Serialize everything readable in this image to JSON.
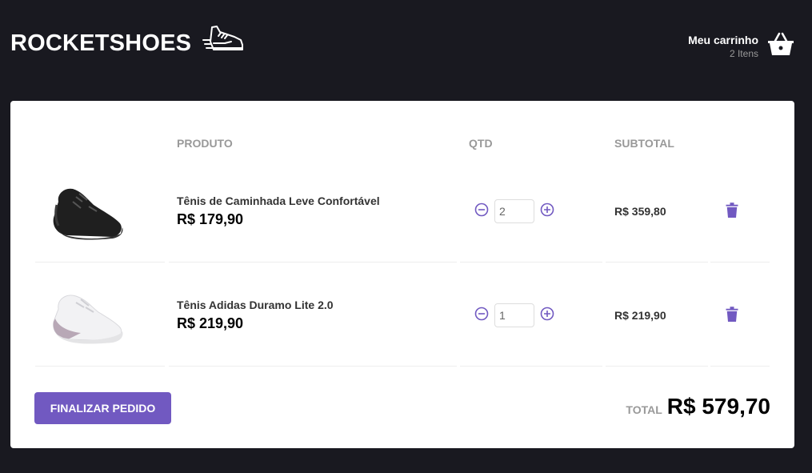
{
  "header": {
    "logo_text": "ROCKETSHOES",
    "cart_title": "Meu carrinho",
    "cart_count": "2 Itens"
  },
  "table": {
    "headers": [
      "PRODUTO",
      "QTD",
      "SUBTOTAL"
    ],
    "rows": [
      {
        "name": "Tênis de Caminhada Leve Confortável",
        "price": "R$ 179,90",
        "quantity": "2",
        "subtotal": "R$ 359,80",
        "image": "black-sneaker-image"
      },
      {
        "name": "Tênis Adidas Duramo Lite 2.0",
        "price": "R$ 219,90",
        "quantity": "1",
        "subtotal": "R$ 219,90",
        "image": "white-sneaker-image"
      }
    ]
  },
  "footer": {
    "checkout_label": "FINALIZAR PEDIDO",
    "total_label": "TOTAL",
    "total_value": "R$ 579,70"
  },
  "colors": {
    "background": "#191920",
    "accent": "#7159c1",
    "card": "#ffffff"
  }
}
